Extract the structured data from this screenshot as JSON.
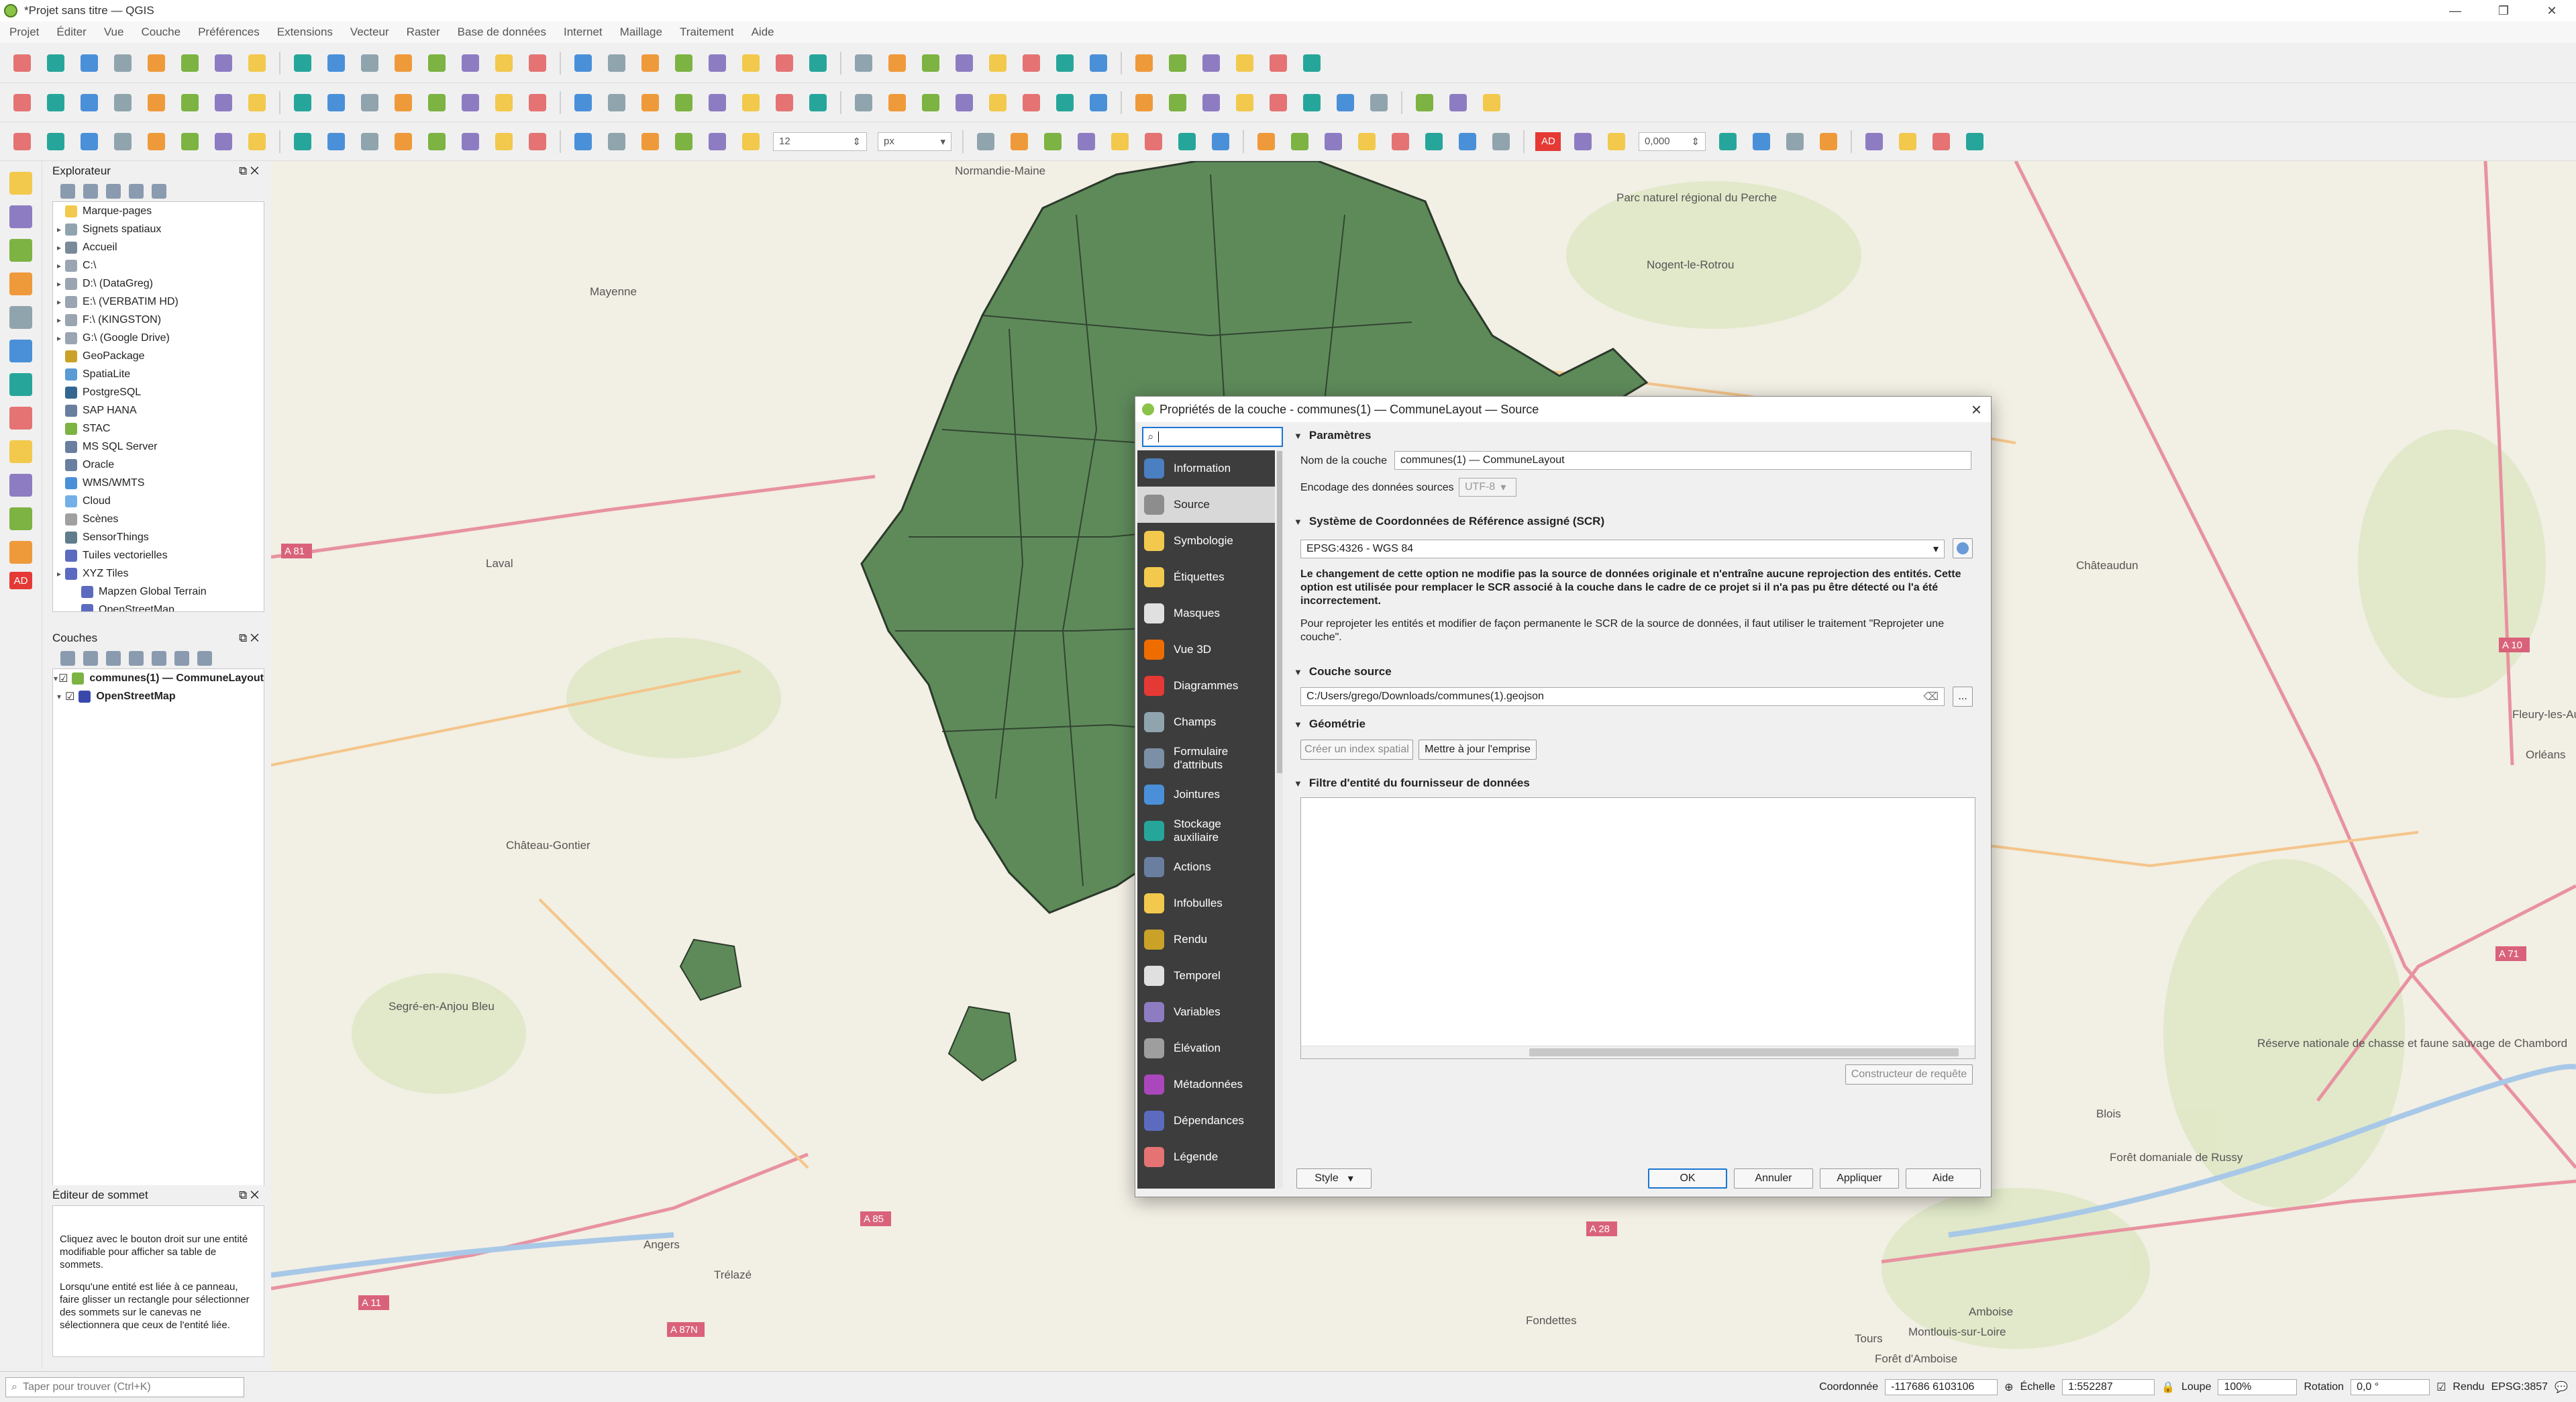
{
  "window": {
    "title": "*Projet sans titre — QGIS",
    "controls": [
      "—",
      "❐",
      "✕"
    ]
  },
  "menubar": [
    "Projet",
    "Éditer",
    "Vue",
    "Couche",
    "Préférences",
    "Extensions",
    "Vecteur",
    "Raster",
    "Base de données",
    "Internet",
    "Maillage",
    "Traitement",
    "Aide"
  ],
  "toolbar": {
    "font_size_value": "12",
    "font_unit": "px",
    "rotation_value": "0,000",
    "ad_badge": "AD"
  },
  "browser": {
    "title": "Explorateur",
    "items": [
      {
        "label": "Marque-pages",
        "icon": "star-icon",
        "expandable": false
      },
      {
        "label": "Signets spatiaux",
        "icon": "bookmark-icon",
        "expandable": true
      },
      {
        "label": "Accueil",
        "icon": "home-icon",
        "expandable": true
      },
      {
        "label": "C:\\",
        "icon": "drive-icon",
        "expandable": true
      },
      {
        "label": "D:\\ (DataGreg)",
        "icon": "drive-icon",
        "expandable": true
      },
      {
        "label": "E:\\ (VERBATIM HD)",
        "icon": "drive-icon",
        "expandable": true
      },
      {
        "label": "F:\\ (KINGSTON)",
        "icon": "drive-icon",
        "expandable": true
      },
      {
        "label": "G:\\ (Google Drive)",
        "icon": "drive-icon",
        "expandable": true
      },
      {
        "label": "GeoPackage",
        "icon": "geopackage-icon",
        "expandable": false
      },
      {
        "label": "SpatiaLite",
        "icon": "spatialite-icon",
        "expandable": false
      },
      {
        "label": "PostgreSQL",
        "icon": "postgresql-icon",
        "expandable": false
      },
      {
        "label": "SAP HANA",
        "icon": "database-icon",
        "expandable": false
      },
      {
        "label": "STAC",
        "icon": "stac-icon",
        "expandable": false
      },
      {
        "label": "MS SQL Server",
        "icon": "database-icon",
        "expandable": false
      },
      {
        "label": "Oracle",
        "icon": "database-icon",
        "expandable": false
      },
      {
        "label": "WMS/WMTS",
        "icon": "globe-icon",
        "expandable": false
      },
      {
        "label": "Cloud",
        "icon": "cloud-icon",
        "expandable": false
      },
      {
        "label": "Scènes",
        "icon": "scene-icon",
        "expandable": false
      },
      {
        "label": "SensorThings",
        "icon": "sensor-icon",
        "expandable": false
      },
      {
        "label": "Tuiles vectorielles",
        "icon": "grid-icon",
        "expandable": false
      },
      {
        "label": "XYZ Tiles",
        "icon": "grid-icon",
        "expandable": true
      },
      {
        "label": "Mapzen Global Terrain",
        "icon": "grid-icon",
        "expandable": false
      },
      {
        "label": "OpenStreetMap",
        "icon": "grid-icon",
        "expandable": false
      }
    ]
  },
  "layers": {
    "title": "Couches",
    "items": [
      {
        "label": "communes(1) — CommuneLayout",
        "checked": true
      },
      {
        "label": "OpenStreetMap",
        "checked": true
      }
    ]
  },
  "vertex_editor": {
    "title": "Éditeur de sommet",
    "text1": "Cliquez avec le bouton droit sur une entité modifiable pour afficher sa table de sommets.",
    "text2": "Lorsqu'une entité est liée à ce panneau, faire glisser un rectangle pour sélectionner des sommets sur le canevas ne sélectionnera que ceux de l'entité liée."
  },
  "map": {
    "places": [
      {
        "label": "Normandie-Maine"
      },
      {
        "label": "Parc naturel régional du Perche"
      },
      {
        "label": "Nogent-le-Rotrou"
      },
      {
        "label": "Mayenne"
      },
      {
        "label": "Laval"
      },
      {
        "label": "Château-Gontier"
      },
      {
        "label": "Segré-en-Anjou Bleu"
      },
      {
        "label": "Angers"
      },
      {
        "label": "Trélazé"
      },
      {
        "label": "Châteaudun"
      },
      {
        "label": "Orléans"
      },
      {
        "label": "Blois"
      },
      {
        "label": "Tours"
      },
      {
        "label": "Amboise"
      },
      {
        "label": "Montlouis-sur-Loire"
      },
      {
        "label": "Fondettes"
      },
      {
        "label": "Forêt domaniale de Russy"
      },
      {
        "label": "Réserve nationale de chasse et faune sauvage de Chambord"
      },
      {
        "label": "Fleury-les-Aubrais"
      },
      {
        "label": "Forêt d'Amboise"
      }
    ],
    "roads": [
      {
        "label": "A 81"
      },
      {
        "label": "A 10"
      },
      {
        "label": "A 71"
      },
      {
        "label": "A 85"
      },
      {
        "label": "A 11"
      },
      {
        "label": "A 87N"
      },
      {
        "label": "A 28"
      }
    ],
    "region_color": "#5e8a5a"
  },
  "dialog": {
    "title": "Propriétés de la couche - communes(1) — CommuneLayout — Source",
    "search_value": "",
    "nav": [
      {
        "label": "Information",
        "icon": "info-icon",
        "active": false
      },
      {
        "label": "Source",
        "icon": "source-icon",
        "active": true
      },
      {
        "label": "Symbologie",
        "icon": "symbology-icon",
        "active": false
      },
      {
        "label": "Étiquettes",
        "icon": "labels-icon",
        "active": false
      },
      {
        "label": "Masques",
        "icon": "masks-icon",
        "active": false
      },
      {
        "label": "Vue 3D",
        "icon": "cube-icon",
        "active": false
      },
      {
        "label": "Diagrammes",
        "icon": "diagram-icon",
        "active": false
      },
      {
        "label": "Champs",
        "icon": "fields-icon",
        "active": false
      },
      {
        "label": "Formulaire d'attributs",
        "icon": "form-icon",
        "active": false
      },
      {
        "label": "Jointures",
        "icon": "joins-icon",
        "active": false
      },
      {
        "label": "Stockage auxiliaire",
        "icon": "storage-icon",
        "active": false
      },
      {
        "label": "Actions",
        "icon": "actions-icon",
        "active": false
      },
      {
        "label": "Infobulles",
        "icon": "tooltip-icon",
        "active": false
      },
      {
        "label": "Rendu",
        "icon": "render-icon",
        "active": false
      },
      {
        "label": "Temporel",
        "icon": "clock-icon",
        "active": false
      },
      {
        "label": "Variables",
        "icon": "variables-icon",
        "active": false
      },
      {
        "label": "Élévation",
        "icon": "elevation-icon",
        "active": false
      },
      {
        "label": "Métadonnées",
        "icon": "metadata-icon",
        "active": false
      },
      {
        "label": "Dépendances",
        "icon": "dependencies-icon",
        "active": false
      },
      {
        "label": "Légende",
        "icon": "legend-icon",
        "active": false
      }
    ],
    "params": {
      "section": "Paramètres",
      "layer_name_label": "Nom de la couche",
      "layer_name_value": "communes(1) — CommuneLayout",
      "encoding_label": "Encodage des données sources",
      "encoding_value": "UTF-8"
    },
    "crs": {
      "section": "Système de Coordonnées de Référence assigné (SCR)",
      "value": "EPSG:4326 - WGS 84",
      "warning": "Le changement de cette option ne modifie pas la source de données originale et n'entraîne aucune reprojection des entités. Cette option est utilisée pour remplacer le SCR associé à la couche dans le cadre de ce projet si il n'a pas pu être détecté ou l'a été incorrectement.",
      "note": "Pour reprojeter les entités et modifier de façon permanente le SCR de la source de données, il faut utiliser le traitement \"Reprojeter une couche\"."
    },
    "source": {
      "section": "Couche source",
      "path": "C:/Users/grego/Downloads/communes(1).geojson",
      "browse": "..."
    },
    "geometry": {
      "section": "Géométrie",
      "create_index": "Créer un index spatial",
      "update_extent": "Mettre à jour l'emprise"
    },
    "filter": {
      "section": "Filtre d'entité du fournisseur de données",
      "query_builder": "Constructeur de requête"
    },
    "buttons": {
      "style": "Style",
      "ok": "OK",
      "cancel": "Annuler",
      "apply": "Appliquer",
      "help": "Aide"
    }
  },
  "status": {
    "search_placeholder": "Taper pour trouver (Ctrl+K)",
    "coord_label": "Coordonnée",
    "coord_value": "-117686  6103106",
    "scale_label": "Échelle",
    "scale_value": "1:552287",
    "magnifier_label": "Loupe",
    "magnifier_value": "100%",
    "rotation_label": "Rotation",
    "rotation_value": "0,0 °",
    "render_label": "Rendu",
    "crs": "EPSG:3857"
  },
  "colors": {
    "accent": "#1976d2",
    "nav_bg": "#3d3d3d",
    "commune_fill": "#5e8a5a"
  }
}
